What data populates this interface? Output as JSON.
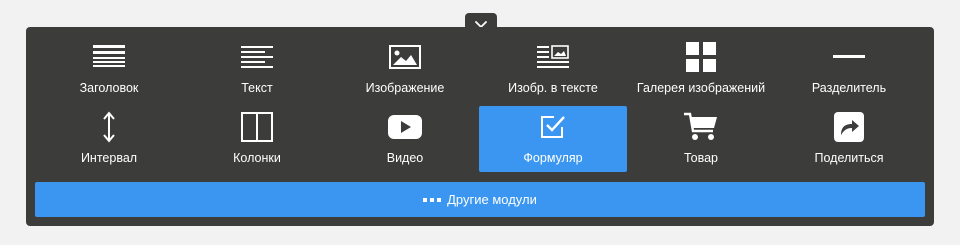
{
  "close_icon": "close-icon",
  "colors": {
    "panel": "#3c3c3b",
    "accent": "#3a96f0",
    "text": "#ffffff",
    "page": "#f2f2f2"
  },
  "modules": [
    {
      "label": "Заголовок",
      "icon": "heading-icon"
    },
    {
      "label": "Текст",
      "icon": "text-icon"
    },
    {
      "label": "Изображение",
      "icon": "image-icon"
    },
    {
      "label": "Изобр. в тексте",
      "icon": "image-in-text-icon"
    },
    {
      "label": "Галерея изображений",
      "icon": "gallery-icon"
    },
    {
      "label": "Разделитель",
      "icon": "divider-icon"
    },
    {
      "label": "Интервал",
      "icon": "spacing-icon"
    },
    {
      "label": "Колонки",
      "icon": "columns-icon"
    },
    {
      "label": "Видео",
      "icon": "video-icon"
    },
    {
      "label": "Формуляр",
      "icon": "form-icon",
      "active": true
    },
    {
      "label": "Товар",
      "icon": "cart-icon"
    },
    {
      "label": "Поделиться",
      "icon": "share-icon"
    }
  ],
  "more_button": {
    "label": "Другие модули",
    "icon": "dots-icon"
  }
}
